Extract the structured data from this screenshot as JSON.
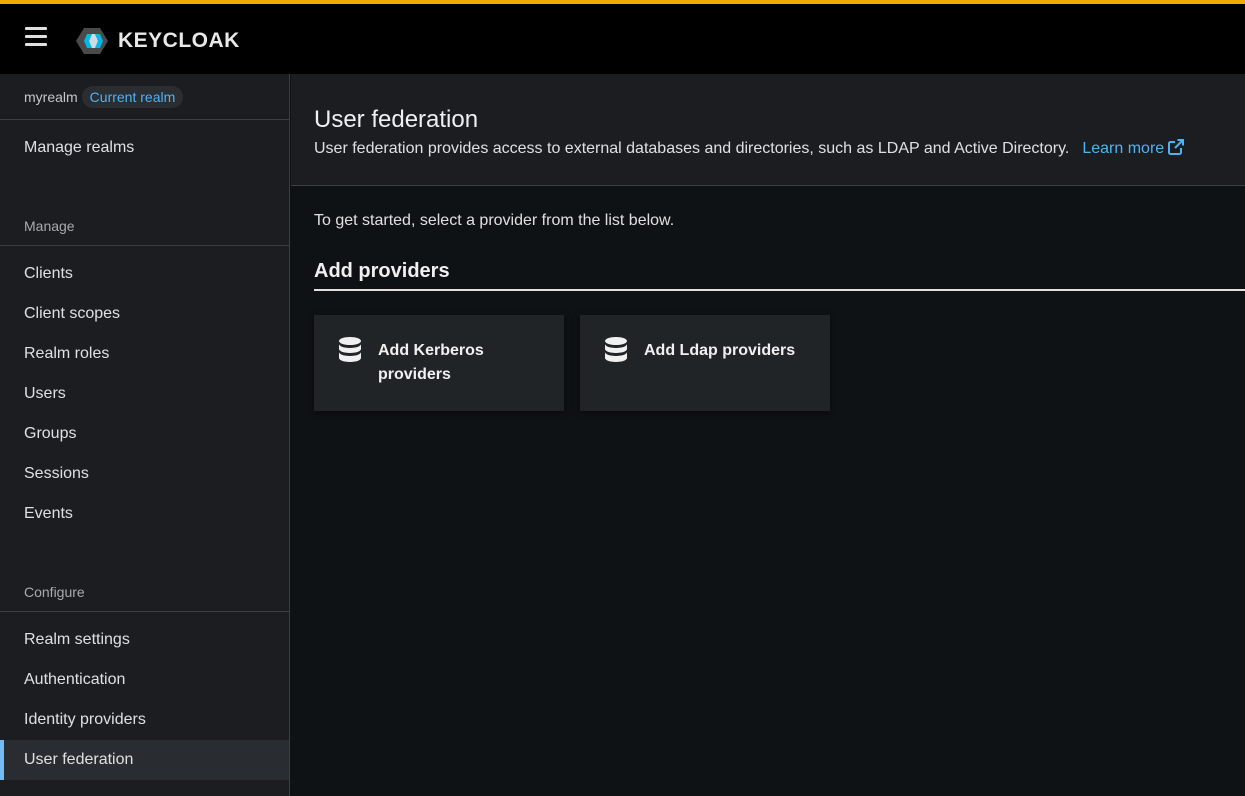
{
  "header": {
    "menu_icon": "hamburger-icon",
    "logo_text": "KEYCLOAK",
    "accent_color": "#f0ab00"
  },
  "sidebar": {
    "realm_name": "myrealm",
    "realm_badge": "Current realm",
    "manage_realms": "Manage realms",
    "manage_title": "Manage",
    "manage_items": [
      {
        "label": "Clients"
      },
      {
        "label": "Client scopes"
      },
      {
        "label": "Realm roles"
      },
      {
        "label": "Users"
      },
      {
        "label": "Groups"
      },
      {
        "label": "Sessions"
      },
      {
        "label": "Events"
      }
    ],
    "configure_title": "Configure",
    "configure_items": [
      {
        "label": "Realm settings"
      },
      {
        "label": "Authentication"
      },
      {
        "label": "Identity providers"
      },
      {
        "label": "User federation"
      }
    ]
  },
  "main": {
    "title": "User federation",
    "description": "User federation provides access to external databases and directories, such as LDAP and Active Directory.",
    "learn_more": "Learn more",
    "intro": "To get started, select a provider from the list below.",
    "section_heading": "Add providers",
    "cards": [
      {
        "label": "Add Kerberos providers",
        "icon": "database-icon"
      },
      {
        "label": "Add Ldap providers",
        "icon": "database-icon"
      }
    ]
  },
  "colors": {
    "link": "#4db4f2",
    "active_indicator": "#73bcf7"
  }
}
